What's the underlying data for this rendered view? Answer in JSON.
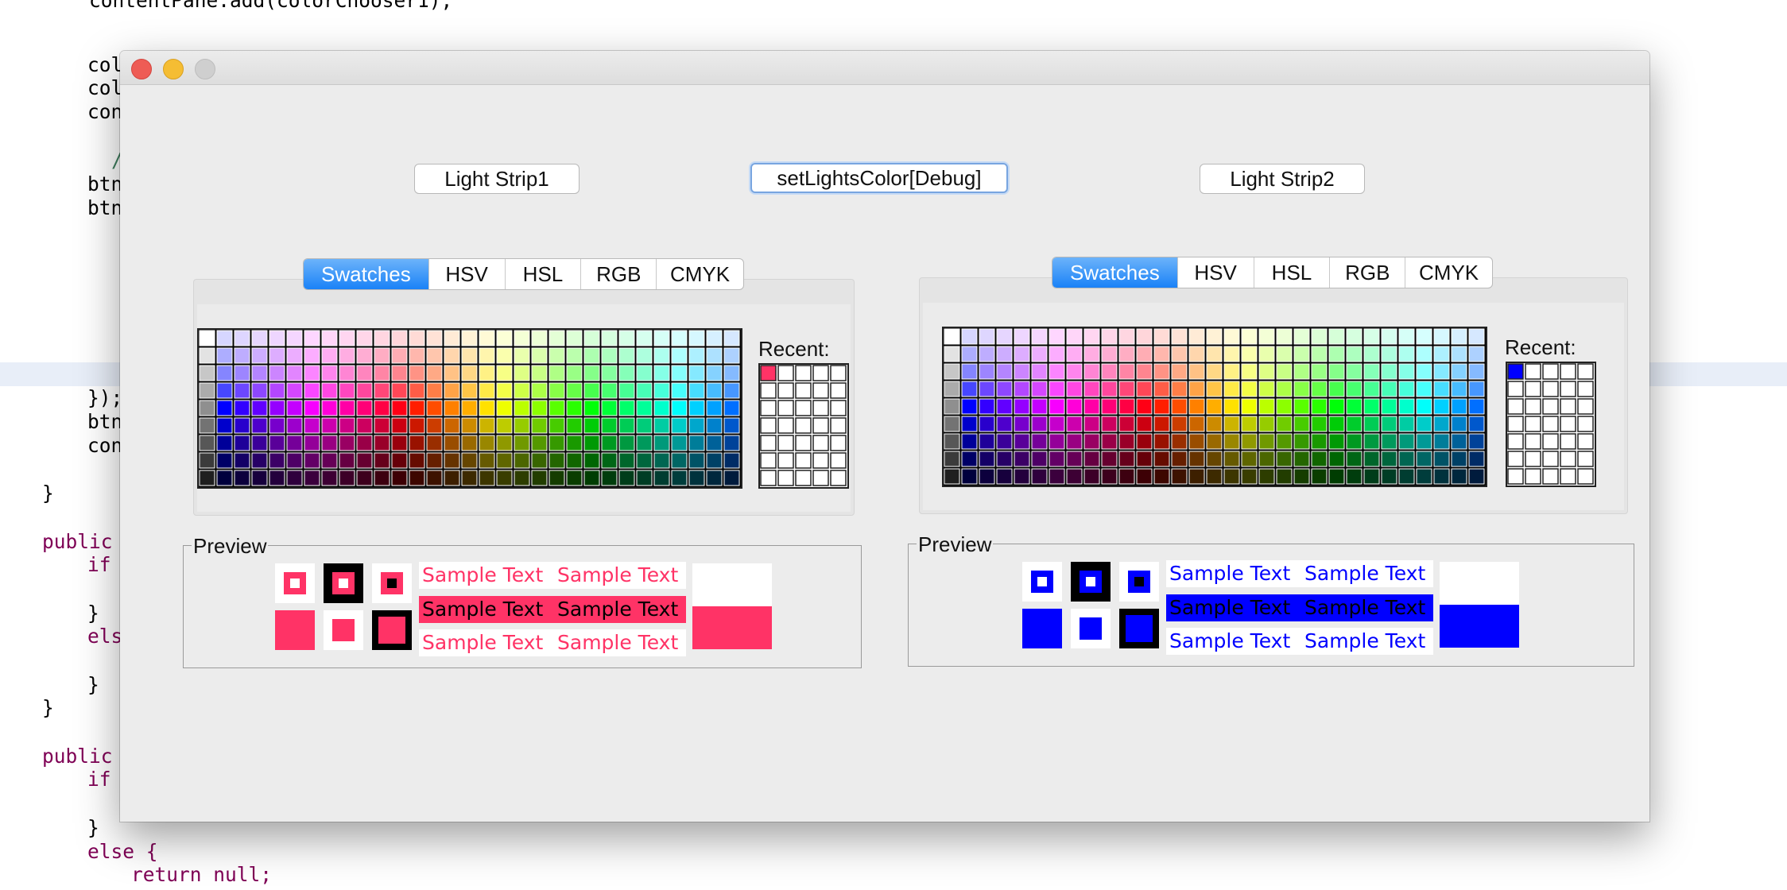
{
  "editor": {
    "lines": [
      {
        "indent": "    ",
        "text": "contentPane.add(colorChooser1);",
        "type": "code"
      },
      {
        "indent": "    ",
        "text": "col",
        "type": "code"
      },
      {
        "indent": "    ",
        "text": "col",
        "type": "code"
      },
      {
        "indent": "    ",
        "text": "con",
        "type": "code"
      },
      {
        "indent": "      ",
        "text": "/",
        "type": "comment"
      },
      {
        "indent": "    ",
        "text": "btn",
        "type": "code"
      },
      {
        "indent": "    ",
        "text": "btn",
        "type": "code"
      },
      {
        "indent": "    ",
        "text": "});",
        "type": "code"
      },
      {
        "indent": "    ",
        "text": "btn",
        "type": "code"
      },
      {
        "indent": "    ",
        "text": "con",
        "type": "code"
      },
      {
        "indent": "",
        "text": "}",
        "type": "code"
      },
      {
        "indent": "",
        "text": "public",
        "type": "kw"
      },
      {
        "indent": "    ",
        "text": "if",
        "type": "kw"
      },
      {
        "indent": "    ",
        "text": "}",
        "type": "code"
      },
      {
        "indent": "    ",
        "text": "els",
        "type": "kw"
      },
      {
        "indent": "    ",
        "text": "}",
        "type": "code"
      },
      {
        "indent": "",
        "text": "}",
        "type": "code"
      },
      {
        "indent": "",
        "text": "public",
        "type": "kw"
      },
      {
        "indent": "    ",
        "text": "if",
        "type": "kw"
      },
      {
        "indent": "    ",
        "text": "}",
        "type": "code"
      },
      {
        "indent": "    ",
        "text": "else {",
        "type": "kw"
      },
      {
        "indent": "        ",
        "text": "return null;",
        "type": "kw"
      }
    ]
  },
  "window": {
    "buttons": {
      "strip1": "Light Strip1",
      "debug": "setLightsColor[Debug]",
      "strip2": "Light Strip2"
    }
  },
  "choosers": [
    {
      "tabs": [
        "Swatches",
        "HSV",
        "HSL",
        "RGB",
        "CMYK"
      ],
      "selected_tab": "Swatches",
      "recent_label": "Recent:",
      "recent_color": "#ff3366",
      "preview_label": "Preview",
      "preview_color": "#ff3366",
      "sample_text": "Sample Text"
    },
    {
      "tabs": [
        "Swatches",
        "HSV",
        "HSL",
        "RGB",
        "CMYK"
      ],
      "selected_tab": "Swatches",
      "recent_label": "Recent:",
      "recent_color": "#0000ff",
      "preview_label": "Preview",
      "preview_color": "#0000ff",
      "sample_text": "Sample Text"
    }
  ],
  "colors": {
    "tab_selected": "#1a82f7",
    "window_bg": "#ececec",
    "close": "#ee5c55",
    "minimize": "#f5bd33",
    "zoom": "#cfcfcf"
  }
}
